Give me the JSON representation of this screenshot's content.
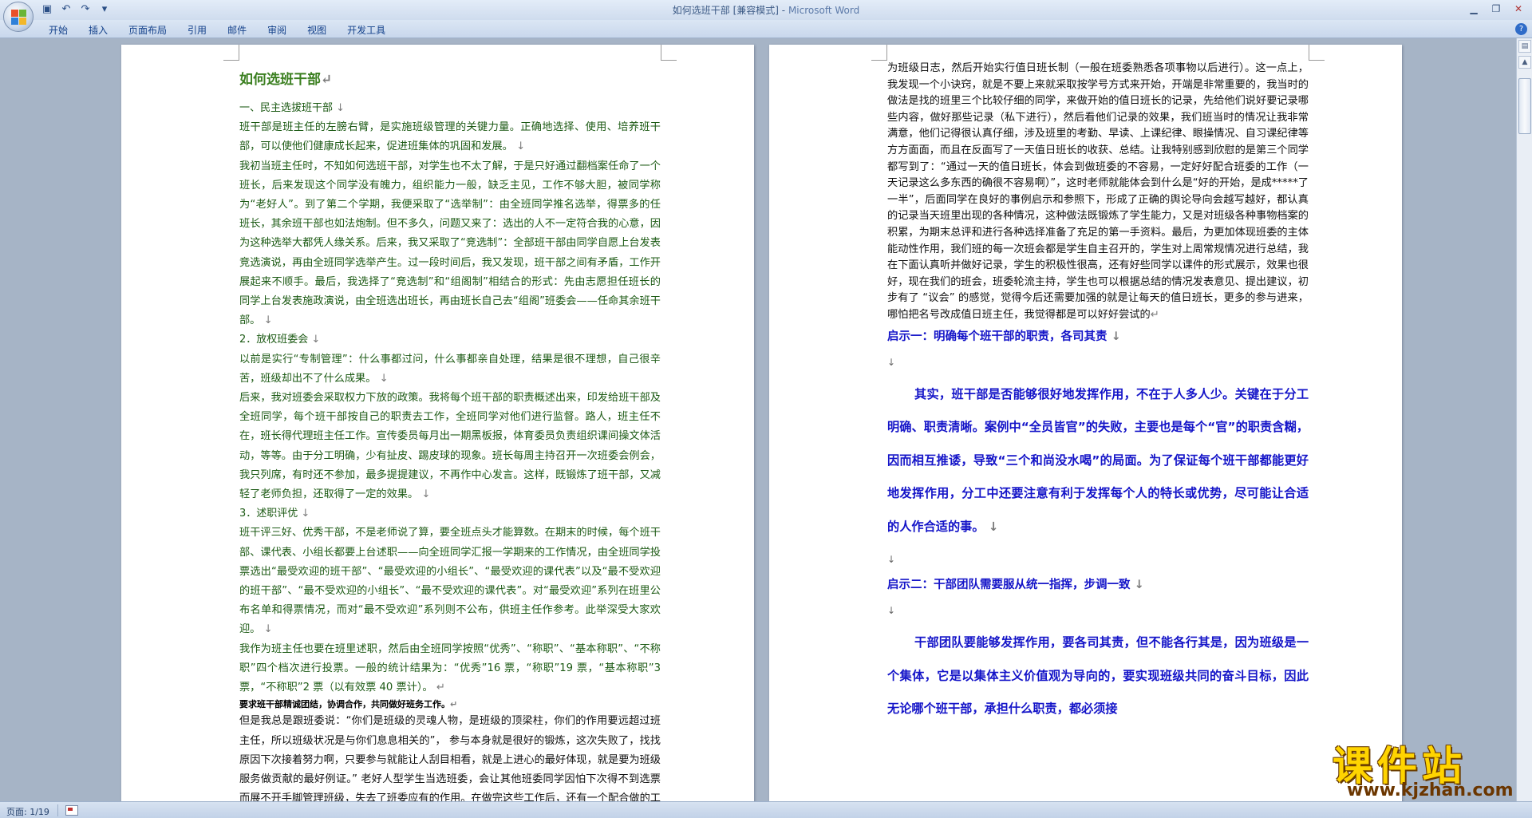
{
  "titlebar": {
    "title": "如何选班干部",
    "mode": " [兼容模式] - ",
    "app": "Microsoft Word"
  },
  "qat": {
    "save_icon": "save-icon",
    "undo_icon": "undo-icon",
    "redo_icon": "redo-icon",
    "customize_icon": "customize-qat-icon"
  },
  "ribbon": {
    "tabs": [
      "开始",
      "插入",
      "页面布局",
      "引用",
      "邮件",
      "审阅",
      "视图",
      "开发工具"
    ]
  },
  "status": {
    "page": "页面: 1/19"
  },
  "watermark": {
    "brand": "课件站",
    "url": "www.kjzhan.com"
  },
  "left_page": {
    "title": "如何选班干部",
    "sec1_head": "一、民主选拔班干部",
    "p1": "班干部是班主任的左膀右臂，是实施班级管理的关键力量。正确地选择、使用、培养班干部，可以使他们健康成长起来，促进班集体的巩固和发展。",
    "p2": "我初当班主任时，不知如何选班干部，对学生也不太了解，于是只好通过翻档案任命了一个班长，后来发现这个同学没有魄力，组织能力一般，缺乏主见，工作不够大胆，被同学称为“老好人”。到了第二个学期，我便采取了“选举制”：由全班同学推名选举，得票多的任班长，其余班干部也如法炮制。但不多久，问题又来了：选出的人不一定符合我的心意，因为这种选举大都凭人缘关系。后来，我又采取了“竞选制”：全部班干部由同学自愿上台发表竞选演说，再由全班同学选举产生。过一段时间后，我又发现，班干部之间有矛盾，工作开展起来不顺手。最后，我选择了“竞选制”和“组阁制”相结合的形式：先由志愿担任班长的同学上台发表施政演说，由全班选出班长，再由班长自己去“组阁”班委会——任命其余班干部。",
    "sec2_head": "2．放权班委会",
    "p3": "以前是实行“专制管理”：什么事都过问，什么事都亲自处理，结果是很不理想，自己很辛苦，班级却出不了什么成果。",
    "p4": "后来，我对班委会采取权力下放的政策。我将每个班干部的职责概述出来，印发给班干部及全班同学，每个班干部按自己的职责去工作，全班同学对他们进行监督。路人，班主任不在，班长得代理班主任工作。宣传委员每月出一期黑板报，体育委员负责组织课间操文体活动，等等。由于分工明确，少有扯皮、踢皮球的现象。班长每周主持召开一次班委会例会，我只列席，有时还不参加，最多提提建议，不再作中心发言。这样，既锻炼了班干部，又减轻了老师负担，还取得了一定的效果。",
    "sec3_head": "3．述职评优",
    "p5": "班干评三好、优秀干部，不是老师说了算，要全班点头才能算数。在期末的时候，每个班干部、课代表、小组长都要上台述职——向全班同学汇报一学期来的工作情况，由全班同学投票选出“最受欢迎的班干部”、“最受欢迎的小组长”、“最受欢迎的课代表”以及“最不受欢迎的班干部”、“最不受欢迎的小组长”、“最不受欢迎的课代表”。对“最受欢迎”系列在班里公布名单和得票情况，而对“最不受欢迎”系列则不公布，供班主任作参考。此举深受大家欢迎。",
    "p6": "我作为班主任也要在班里述职，然后由全班同学按照“优秀”、“称职”、“基本称职”、“不称职”四个档次进行投票。一般的统计结果为：“优秀”16 票，“称职”19 票，“基本称职”3 票，“不称职”2 票（以有效票 40 票计）。",
    "p7": "要求班干部精诚团结，协调合作，共同做好班务工作。",
    "p8": "但是我总是跟班委说：“你们是班级的灵魂人物，是班级的顶梁柱，你们的作用要远超过班主任，所以班级状况是与你们息息相关的”， 参与本身就是很好的锻炼，这次失败了，找找原因下次接着努力啊，只要参与就能让人刮目相看，就是上进心的最好体现，就是要为班级服务做贡献的最好例证。” 老好人型学生当选班委，会让其他班委同学因怕下次得不到选票而展不开手脚管理班级，失去了班委应有的作用。在做完这些工作后，还有一个配合做的工作就是值日班长。这时可以找一个硬皮本（要质量好一些的），作"
  },
  "right_page": {
    "p1": "为班级日志，然后开始实行值日班长制（一般在班委熟悉各项事物以后进行）。这一点上，我发现一个小诀窍，就是不要上来就采取按学号方式来开始，开端是非常重要的，我当时的做法是找的班里三个比较仔细的同学，来做开始的值日班长的记录，先给他们说好要记录哪些内容，做好那些记录（私下进行），然后看他们记录的效果，我们班当时的情况让我非常满意，他们记得很认真仔细，涉及班里的考勤、早读、上课纪律、眼操情况、自习课纪律等方方面面，而且在反面写了一天值日班长的收获、总结。让我特别感到欣慰的是第三个同学都写到了：“通过一天的值日班长，体会到做班委的不容易，一定好好配合班委的工作（一天记录这么多东西的确很不容易啊）”，这时老师就能体会到什么是“好的开始，是成*****了一半”，后面同学在良好的事例启示和参照下，形成了正确的舆论导向会越写越好，都认真的记录当天班里出现的各种情况，这种做法既锻炼了学生能力，又是对班级各种事物档案的积累，为期末总评和进行各种选择准备了充足的第一手资料。最后，为更加体现班委的主体能动性作用，我们班的每一次班会都是学生自主召开的，学生对上周常规情况进行总结，我在下面认真听并做好记录，学生的积极性很高，还有好些同学以课件的形式展示，效果也很好，现在我们的班会，班委轮流主持，学生也可以根据总结的情况发表意见、提出建议，初步有了 “议会” 的感觉，觉得今后还需要加强的就是让每天的值日班长，更多的参与进来，哪怕把名号改成值日班主任，我觉得都是可以好好尝试的",
    "h1": "启示一：明确每个班干部的职责，各司其责",
    "b1": "其实，班干部是否能够很好地发挥作用，不在于人多人少。关键在于分工明确、职责清晰。案例中“全员皆官”的失败，主要也是每个“官”的职责含糊，因而相互推诿，导致“三个和尚没水喝”的局面。为了保证每个班干部都能更好地发挥作用，分工中还要注意有利于发挥每个人的特长或优势，尽可能让合适的人作合适的事。",
    "h2": "启示二：干部团队需要服从统一指挥，步调一致",
    "b2": "干部团队要能够发挥作用，要各司其责，但不能各行其是，因为班级是一个集体，它是以集体主义价值观为导向的，要实现班级共同的奋斗目标，因此无论哪个班干部，承担什么职责，都必须接"
  },
  "marks": {
    "para": "↓",
    "end": "↵"
  },
  "colors": {
    "left_text": "#1c5a14",
    "left_title": "#3b7f20",
    "right_hint": "#1414c8"
  }
}
